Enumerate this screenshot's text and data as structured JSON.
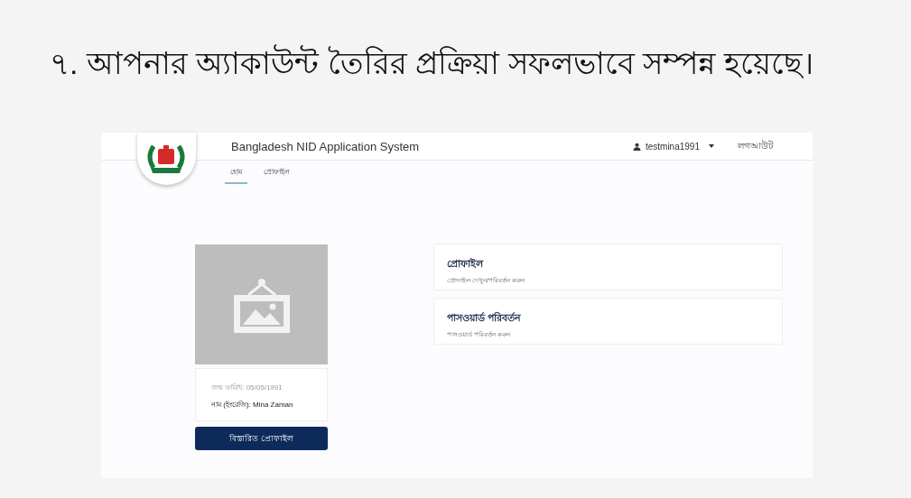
{
  "heading": "৭. আপনার অ্যাকাউন্ট তৈরির প্রক্রিয়া সফলভাবে সম্পন্ন হয়েছে।",
  "app": {
    "title": "Bangladesh NID Application System",
    "user": "testmina1991",
    "logout": "লগআউট",
    "tabs": [
      {
        "label": "হোম",
        "selected": true
      },
      {
        "label": "প্রোফাইল",
        "selected": false
      }
    ],
    "profile": {
      "birth_date": "জন্ম তারিখ: 05/05/1991",
      "name": "নাম (ইংরেজি): Mina Zaman",
      "button": "বিস্তারিত প্রোফাইল"
    },
    "cards": [
      {
        "title": "প্রোফাইল",
        "subtitle": "প্রোফাইল দেখুন/পরিবর্তন করুন"
      },
      {
        "title": "পাসওয়ার্ড পরিবর্তন",
        "subtitle": "পাসওয়ার্ড পরিবর্তন করুন"
      }
    ]
  }
}
